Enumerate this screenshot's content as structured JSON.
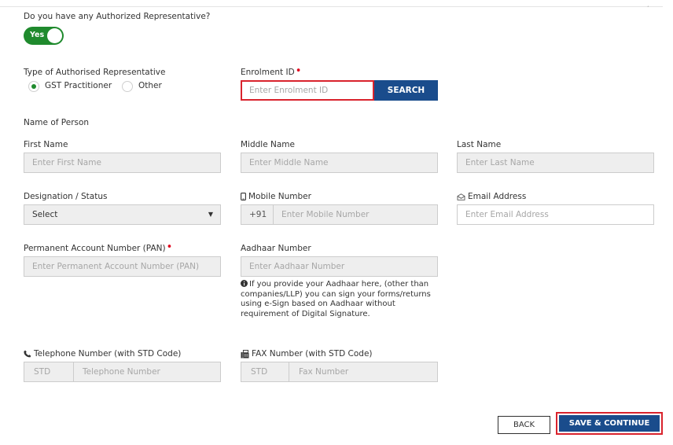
{
  "corner_mark": "ˏ",
  "authorized_rep": {
    "question": "Do you have any Authorized Representative?",
    "toggle_label": "Yes",
    "toggle_on": true
  },
  "rep_type": {
    "label": "Type of Authorised Representative",
    "options": [
      {
        "label": "GST Practitioner",
        "checked": true
      },
      {
        "label": "Other",
        "checked": false
      }
    ]
  },
  "enrolment": {
    "label": "Enrolment ID",
    "required_mark": "•",
    "placeholder": "Enter Enrolment ID",
    "search_label": "SEARCH"
  },
  "name_section": {
    "heading": "Name of Person",
    "first_label": "First Name",
    "first_placeholder": "Enter First Name",
    "middle_label": "Middle Name",
    "middle_placeholder": "Enter Middle Name",
    "last_label": "Last Name",
    "last_placeholder": "Enter Last Name"
  },
  "designation": {
    "label": "Designation / Status",
    "selected": "Select",
    "caret": "▼"
  },
  "mobile": {
    "label": "Mobile Number",
    "icon": "mobile-icon",
    "prefix": "+91",
    "placeholder": "Enter Mobile Number"
  },
  "email": {
    "label": "Email Address",
    "icon": "envelope-icon",
    "placeholder": "Enter Email Address"
  },
  "pan": {
    "label": "Permanent Account Number (PAN)",
    "required_mark": "•",
    "placeholder": "Enter Permanent Account Number (PAN)"
  },
  "aadhaar": {
    "label": "Aadhaar Number",
    "placeholder": "Enter Aadhaar Number",
    "info_icon": "info-icon",
    "note": "If you provide your Aadhaar here, (other than companies/LLP) you can sign your forms/returns using e-Sign based on Aadhaar without requirement of Digital Signature."
  },
  "telephone": {
    "label": "Telephone Number (with STD Code)",
    "icon": "phone-icon",
    "std_placeholder": "STD",
    "number_placeholder": "Telephone Number"
  },
  "fax": {
    "label": "FAX Number (with STD Code)",
    "icon": "fax-icon",
    "std_placeholder": "STD",
    "number_placeholder": "Fax Number"
  },
  "actions": {
    "back_label": "BACK",
    "save_label": "SAVE & CONTINUE"
  },
  "colors": {
    "accent_green": "#1f8a2d",
    "primary_blue": "#1a4c8c",
    "highlight_red": "#d9232d"
  }
}
